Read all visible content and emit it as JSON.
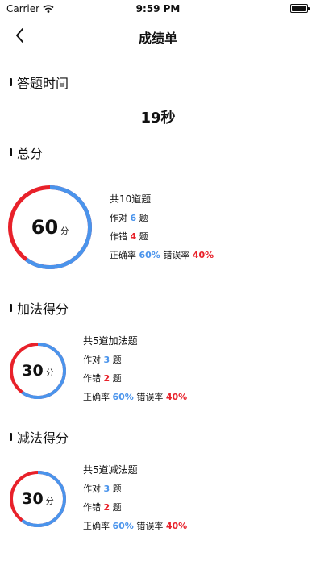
{
  "status": {
    "carrier": "Carrier",
    "time": "9:59 PM"
  },
  "nav": {
    "title": "成绩单"
  },
  "time_section": {
    "title": "答题时间",
    "value": "19秒"
  },
  "total": {
    "title": "总分",
    "score": "60",
    "unit": "分",
    "correct_fraction": 0.6,
    "total_text": "共10道题",
    "correct_label": "作对",
    "correct_count": "6",
    "wrong_label": "作错",
    "wrong_count": "4",
    "unit_q": "题",
    "rate_label": "正确率",
    "rate": "60%",
    "err_label": "错误率",
    "err_rate": "40%"
  },
  "addition": {
    "title": "加法得分",
    "score": "30",
    "unit": "分",
    "correct_fraction": 0.6,
    "total_text": "共5道加法题",
    "correct_label": "作对",
    "correct_count": "3",
    "wrong_label": "作错",
    "wrong_count": "2",
    "unit_q": "题",
    "rate_label": "正确率",
    "rate": "60%",
    "err_label": "错误率",
    "err_rate": "40%"
  },
  "subtraction": {
    "title": "减法得分",
    "score": "30",
    "unit": "分",
    "correct_fraction": 0.6,
    "total_text": "共5道减法题",
    "correct_label": "作对",
    "correct_count": "3",
    "wrong_label": "作错",
    "wrong_count": "2",
    "unit_q": "题",
    "rate_label": "正确率",
    "rate": "60%",
    "err_label": "错误率",
    "err_rate": "40%"
  },
  "colors": {
    "correct": "#4a94ec",
    "wrong": "#e8212a"
  }
}
